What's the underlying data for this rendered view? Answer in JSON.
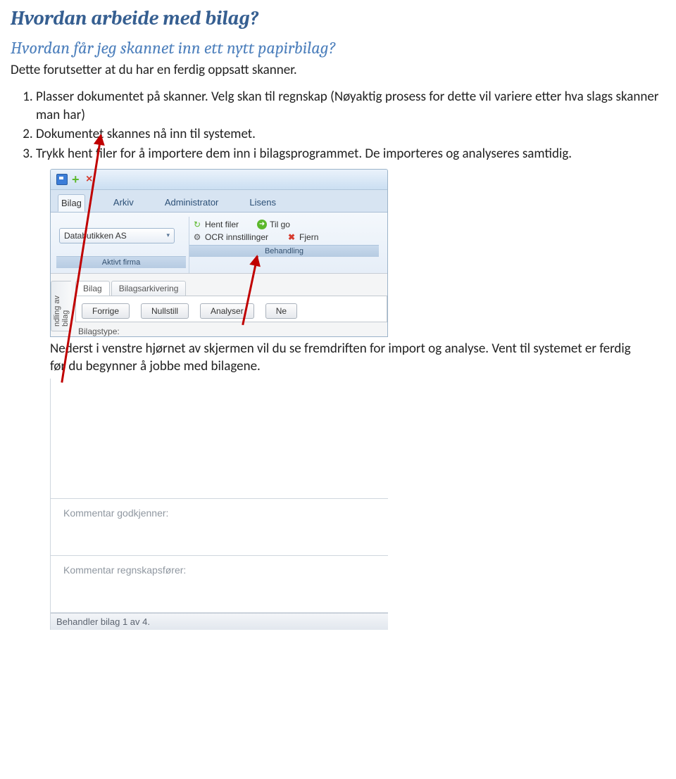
{
  "headings": {
    "h1": "Hvordan arbeide med bilag?",
    "h2": "Hvordan får jeg skannet inn ett nytt papirbilag?"
  },
  "intro": "Dette forutsetter at du har en ferdig oppsatt skanner.",
  "steps": [
    "Plasser dokumentet på skanner. Velg skan til regnskap (Nøyaktig prosess for dette vil variere etter hva slags skanner man har)",
    "Dokumentet skannes nå inn til systemet.",
    "Trykk hent filer for å importere dem inn i bilagsprogrammet. De importeres og analyseres samtidig."
  ],
  "app": {
    "ribbon_tabs": [
      "Bilag",
      "Arkiv",
      "Administrator",
      "Lisens"
    ],
    "active_firm_group": "Aktivt firma",
    "behandling_group": "Behandling",
    "firm_dropdown": "Databutikken AS",
    "btn_hent_filer": "Hent filer",
    "btn_ocr": "OCR innstillinger",
    "btn_til_go": "Til go",
    "btn_fjern": "Fjern",
    "side_tab": "ndling av bilag",
    "subtabs": [
      "Bilag",
      "Bilagsarkivering"
    ],
    "action_buttons": [
      "Forrige",
      "Nullstill",
      "Analyser",
      "Ne"
    ],
    "bilagstype_label": "Bilagstype:"
  },
  "after_text": "Nederst i venstre hjørnet av skjermen vil du se fremdriften for import og analyse. Vent til systemet er ferdig før du begynner å jobbe med bilagene.",
  "comments": {
    "field1": "Kommentar godkjenner:",
    "field2": "Kommentar regnskapsfører:"
  },
  "status_bar": "Behandler bilag 1 av 4."
}
